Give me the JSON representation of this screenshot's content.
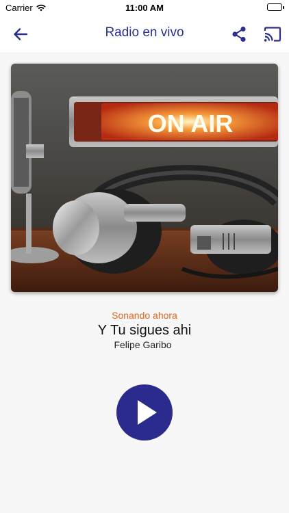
{
  "status_bar": {
    "carrier": "Carrier",
    "time": "11:00 AM"
  },
  "nav": {
    "title": "Radio en vivo",
    "back_icon": "arrow-left-icon",
    "share_icon": "share-icon",
    "cast_icon": "cast-icon"
  },
  "artwork": {
    "sign_text": "ON AIR"
  },
  "now_playing": {
    "label": "Sonando ahora",
    "title": "Y Tu sigues ahi",
    "artist": "Felipe Garibo"
  },
  "player": {
    "play_icon": "play-icon"
  },
  "colors": {
    "accent": "#2a2f8f",
    "play_button": "#2a2b8c",
    "now_label": "#e0661c",
    "background": "#f7f7f8"
  }
}
